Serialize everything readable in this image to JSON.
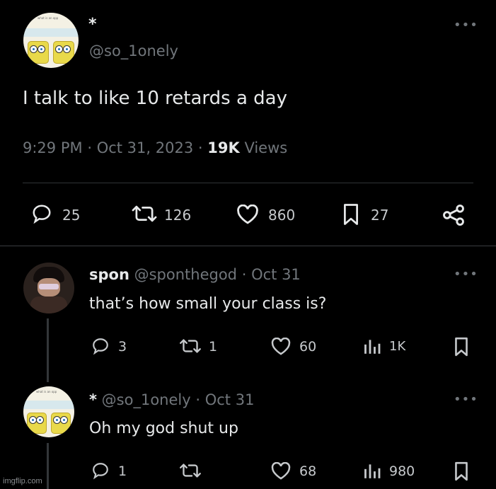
{
  "main_tweet": {
    "display_name": "*",
    "handle": "@so_1onely",
    "text": "I talk to like 10 retards a day",
    "time": "9:29 PM",
    "date": "Oct 31, 2023",
    "views_count": "19K",
    "views_label": "Views",
    "replies": "25",
    "reposts": "126",
    "likes": "860",
    "bookmarks": "27",
    "avatar_caption": "what is an opp"
  },
  "replies": [
    {
      "display_name": "spon",
      "handle": "@sponthegod",
      "date": "Oct 31",
      "text": "that’s how small your class is?",
      "replies": "3",
      "reposts": "1",
      "likes": "60",
      "views": "1K"
    },
    {
      "display_name": "*",
      "handle": "@so_1onely",
      "date": "Oct 31",
      "text": "Oh my god shut up",
      "replies": "1",
      "reposts": "",
      "likes": "68",
      "views": "980",
      "avatar_caption": "what is an opp"
    }
  ],
  "separator": "·",
  "watermark": "imgflip.com",
  "colors": {
    "background": "#000000",
    "text": "#e7e9ea",
    "muted": "#71767b",
    "divider": "#2f3336"
  }
}
